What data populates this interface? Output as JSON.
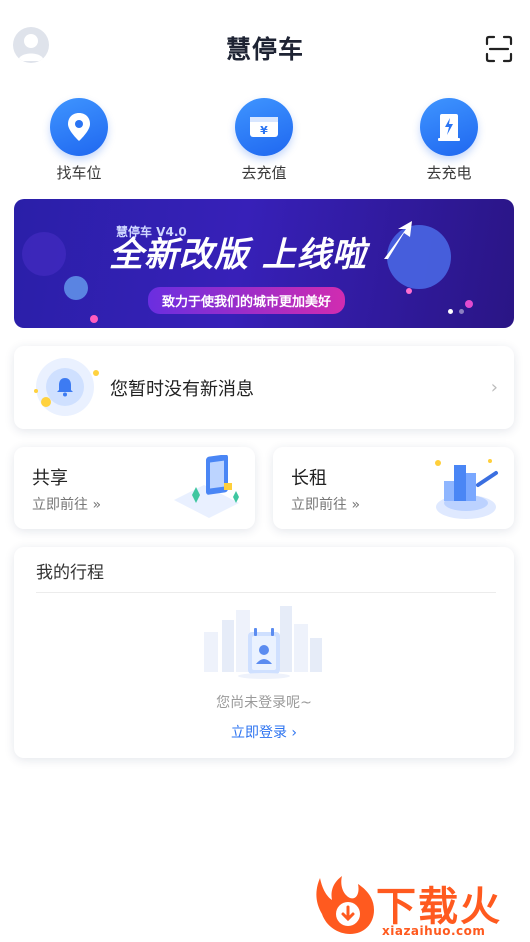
{
  "header": {
    "title": "慧停车"
  },
  "quick_actions": [
    {
      "label": "找车位",
      "icon": "location-pin-icon"
    },
    {
      "label": "去充值",
      "icon": "wallet-icon"
    },
    {
      "label": "去充电",
      "icon": "charging-station-icon"
    }
  ],
  "banner": {
    "brand_line": "慧停车 V4.0",
    "headline": "全新改版 上线啦",
    "slogan": "致力于使我们的城市更加美好",
    "slide_count": 2,
    "active_slide": 1
  },
  "message": {
    "text": "您暂时没有新消息"
  },
  "tiles": [
    {
      "title": "共享",
      "link": "立即前往"
    },
    {
      "title": "长租",
      "link": "立即前往"
    }
  ],
  "trip": {
    "title": "我的行程",
    "empty_text": "您尚未登录呢~",
    "login_link": "立即登录"
  },
  "watermark": {
    "text": "下载火",
    "url": "xiazaihuo.com"
  },
  "colors": {
    "accent": "#2e74f0",
    "banner_bg": "#3720b8",
    "watermark": "#ff5a1f"
  }
}
